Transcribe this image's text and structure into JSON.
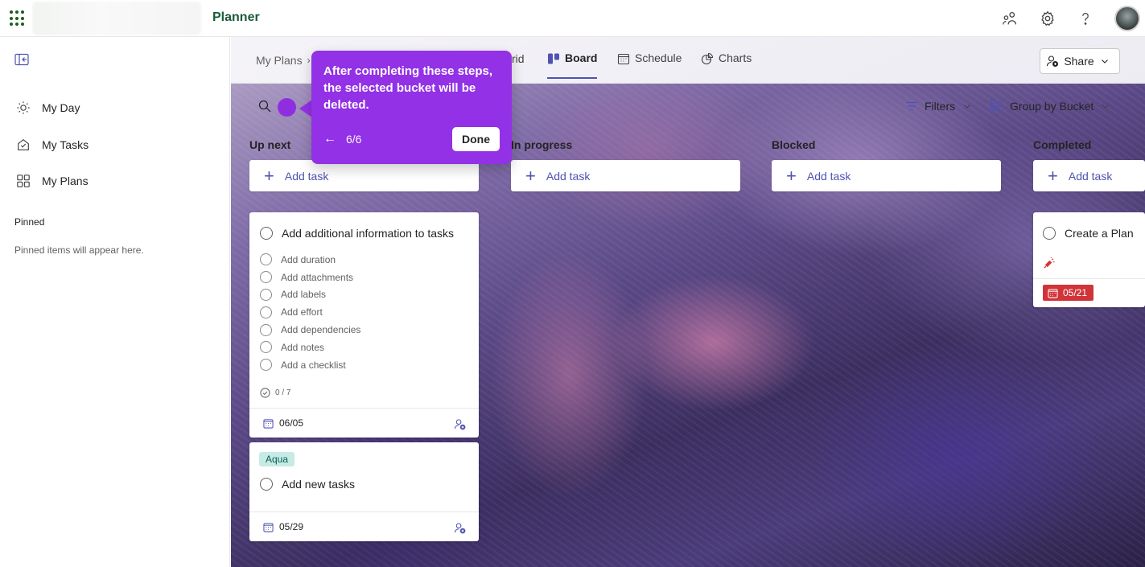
{
  "app": {
    "title": "Planner"
  },
  "topbar": {
    "icons": [
      "share-people-icon",
      "gear-icon",
      "help-icon",
      "avatar"
    ]
  },
  "leftnav": {
    "items": [
      {
        "label": "My Day",
        "icon": "sun-icon"
      },
      {
        "label": "My Tasks",
        "icon": "home-check-icon"
      },
      {
        "label": "My Plans",
        "icon": "grid-icon"
      }
    ],
    "pinned_title": "Pinned",
    "pinned_empty": "Pinned items will appear here."
  },
  "tabbar": {
    "breadcrumb": "My Plans",
    "partial_tab": "rid",
    "tabs": [
      {
        "label": "Board",
        "active": true
      },
      {
        "label": "Schedule",
        "active": false
      },
      {
        "label": "Charts",
        "active": false
      }
    ],
    "share_label": "Share"
  },
  "filterbar": {
    "filters_label": "Filters",
    "groupby_label": "Group by Bucket"
  },
  "buckets": [
    {
      "title": "Up next",
      "add_label": "Add task"
    },
    {
      "title": "In progress",
      "add_label": "Add task"
    },
    {
      "title": "Blocked",
      "add_label": "Add task"
    },
    {
      "title": "Completed",
      "add_label": "Add task"
    }
  ],
  "cards": {
    "card1": {
      "title": "Add additional information to tasks",
      "checklist": [
        "Add duration",
        "Add attachments",
        "Add labels",
        "Add effort",
        "Add dependencies",
        "Add notes",
        "Add a checklist"
      ],
      "progress": "0 / 7",
      "due": "06/05"
    },
    "card2": {
      "label": "Aqua",
      "title": "Add new tasks",
      "due": "05/29"
    },
    "card3": {
      "title": "Create a Plan",
      "due": "05/21"
    }
  },
  "tour": {
    "text": "After completing these steps, the selected bucket will be deleted.",
    "back": "←",
    "count": "6/6",
    "done_label": "Done"
  },
  "colors": {
    "brand_green": "#185c37",
    "accent": "#4f52b2",
    "tour_purple": "#9331e6",
    "overdue_red": "#d13438",
    "label_aqua": "#c6ebe5"
  }
}
